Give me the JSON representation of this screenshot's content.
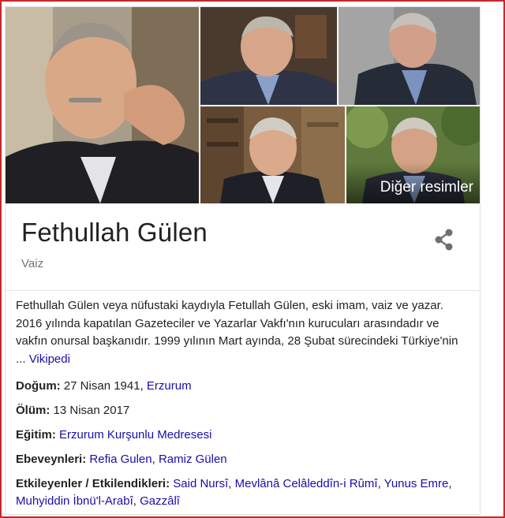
{
  "gallery": {
    "more_images_label": "Diğer resimler"
  },
  "entity": {
    "title": "Fethullah Gülen",
    "subtitle": "Vaiz"
  },
  "description": {
    "text": "Fethullah Gülen veya nüfustaki kaydıyla Fetullah Gülen, eski imam, vaiz ve yazar. 2016 yılında kapatılan Gazeteciler ve Yazarlar Vakfı'nın kurucuları arasındadır ve vakfın onursal başkanıdır. 1999 yılının Mart ayında, 28 Şubat sürecindeki Türkiye'nin ...",
    "source_link": "Vikipedi"
  },
  "facts": {
    "birth": {
      "label": "Doğum:",
      "value": "27 Nisan 1941,",
      "link": "Erzurum"
    },
    "death": {
      "label": "Ölüm:",
      "value": "13 Nisan 2017"
    },
    "education": {
      "label": "Eğitim:",
      "link": "Erzurum Kurşunlu Medresesi"
    },
    "parents": {
      "label": "Ebeveynleri:",
      "links": [
        "Refia Gulen",
        "Ramiz Gülen"
      ],
      "separator": ","
    },
    "influences": {
      "label": "Etkileyenler / Etkilendikleri:",
      "links": [
        "Said Nursî",
        "Mevlânâ Celâleddîn-i Rûmî",
        "Yunus Emre",
        "Muhyiddin İbnü'l-Arabî",
        "Gazzâlî"
      ],
      "separator": ","
    }
  },
  "icons": {
    "share": "share-icon"
  },
  "colors": {
    "link": "#1a0dab",
    "title": "#222222",
    "subtitle": "#70757a",
    "frame": "#c62828"
  }
}
